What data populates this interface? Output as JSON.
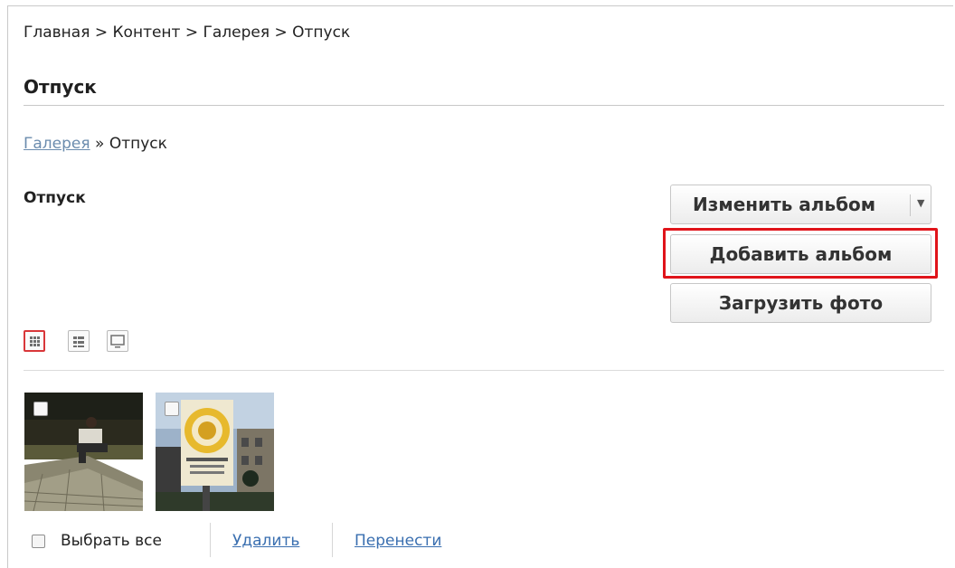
{
  "top_breadcrumb": "Главная > Контент > Галерея > Отпуск",
  "page_title": "Отпуск",
  "gallery_breadcrumb": {
    "link": "Галерея",
    "separator": " » ",
    "current": "Отпуск"
  },
  "album": {
    "title": "Отпуск"
  },
  "actions": {
    "edit_album": "Изменить альбом",
    "add_album": "Добавить альбом",
    "upload_photo": "Загрузить фото"
  },
  "view_modes": [
    "grid-view-icon",
    "list-view-icon",
    "slideshow-view-icon"
  ],
  "photos": [
    {
      "icon": "photo-person-on-embankment"
    },
    {
      "icon": "photo-poster-on-street"
    }
  ],
  "footer": {
    "select_all": "Выбрать все",
    "delete": "Удалить",
    "move": "Перенести"
  },
  "colors": {
    "highlight": "#e0141a",
    "link": "#3a6fb0",
    "breadcrumb_link": "#6b8cae"
  }
}
